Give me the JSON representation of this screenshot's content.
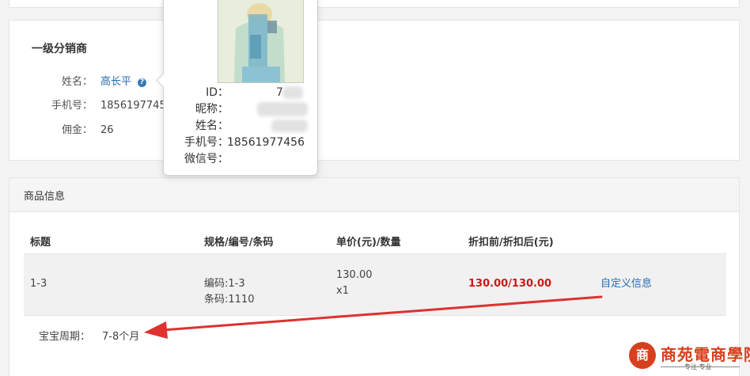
{
  "distributor": {
    "title": "一级分销商",
    "name_label": "姓名：",
    "name_value": "高长平",
    "phone_label": "手机号：",
    "phone_value": "1856197745",
    "commission_label": "佣金：",
    "commission_value": "26"
  },
  "popover": {
    "id_label": "ID：",
    "id_value": "7",
    "nickname_label": "昵称：",
    "name_label": "姓名：",
    "phone_label": "手机号：",
    "phone_value": "18561977456",
    "wechat_label": "微信号："
  },
  "product": {
    "section_title": "商品信息",
    "columns": [
      "标题",
      "规格/编号/条码",
      "单价(元)/数量",
      "折扣前/折扣后(元)"
    ],
    "row": {
      "title": "1-3",
      "code": "编码:1-3",
      "barcode": "条码:1110",
      "unit_price": "130.00",
      "quantity": "x1",
      "price_before_after": "130.00/130.00",
      "custom_link": "自定义信息"
    },
    "period_label": "宝宝周期：",
    "period_value": "7-8个月"
  },
  "watermark": {
    "logo_char": "商",
    "title": "商苑電商學院",
    "subtitle": "专注·专业"
  },
  "colors": {
    "accent_red": "#c81a1a",
    "link_blue": "#2a6db0",
    "arrow_red": "#e03030",
    "watermark": "#d7401f"
  }
}
